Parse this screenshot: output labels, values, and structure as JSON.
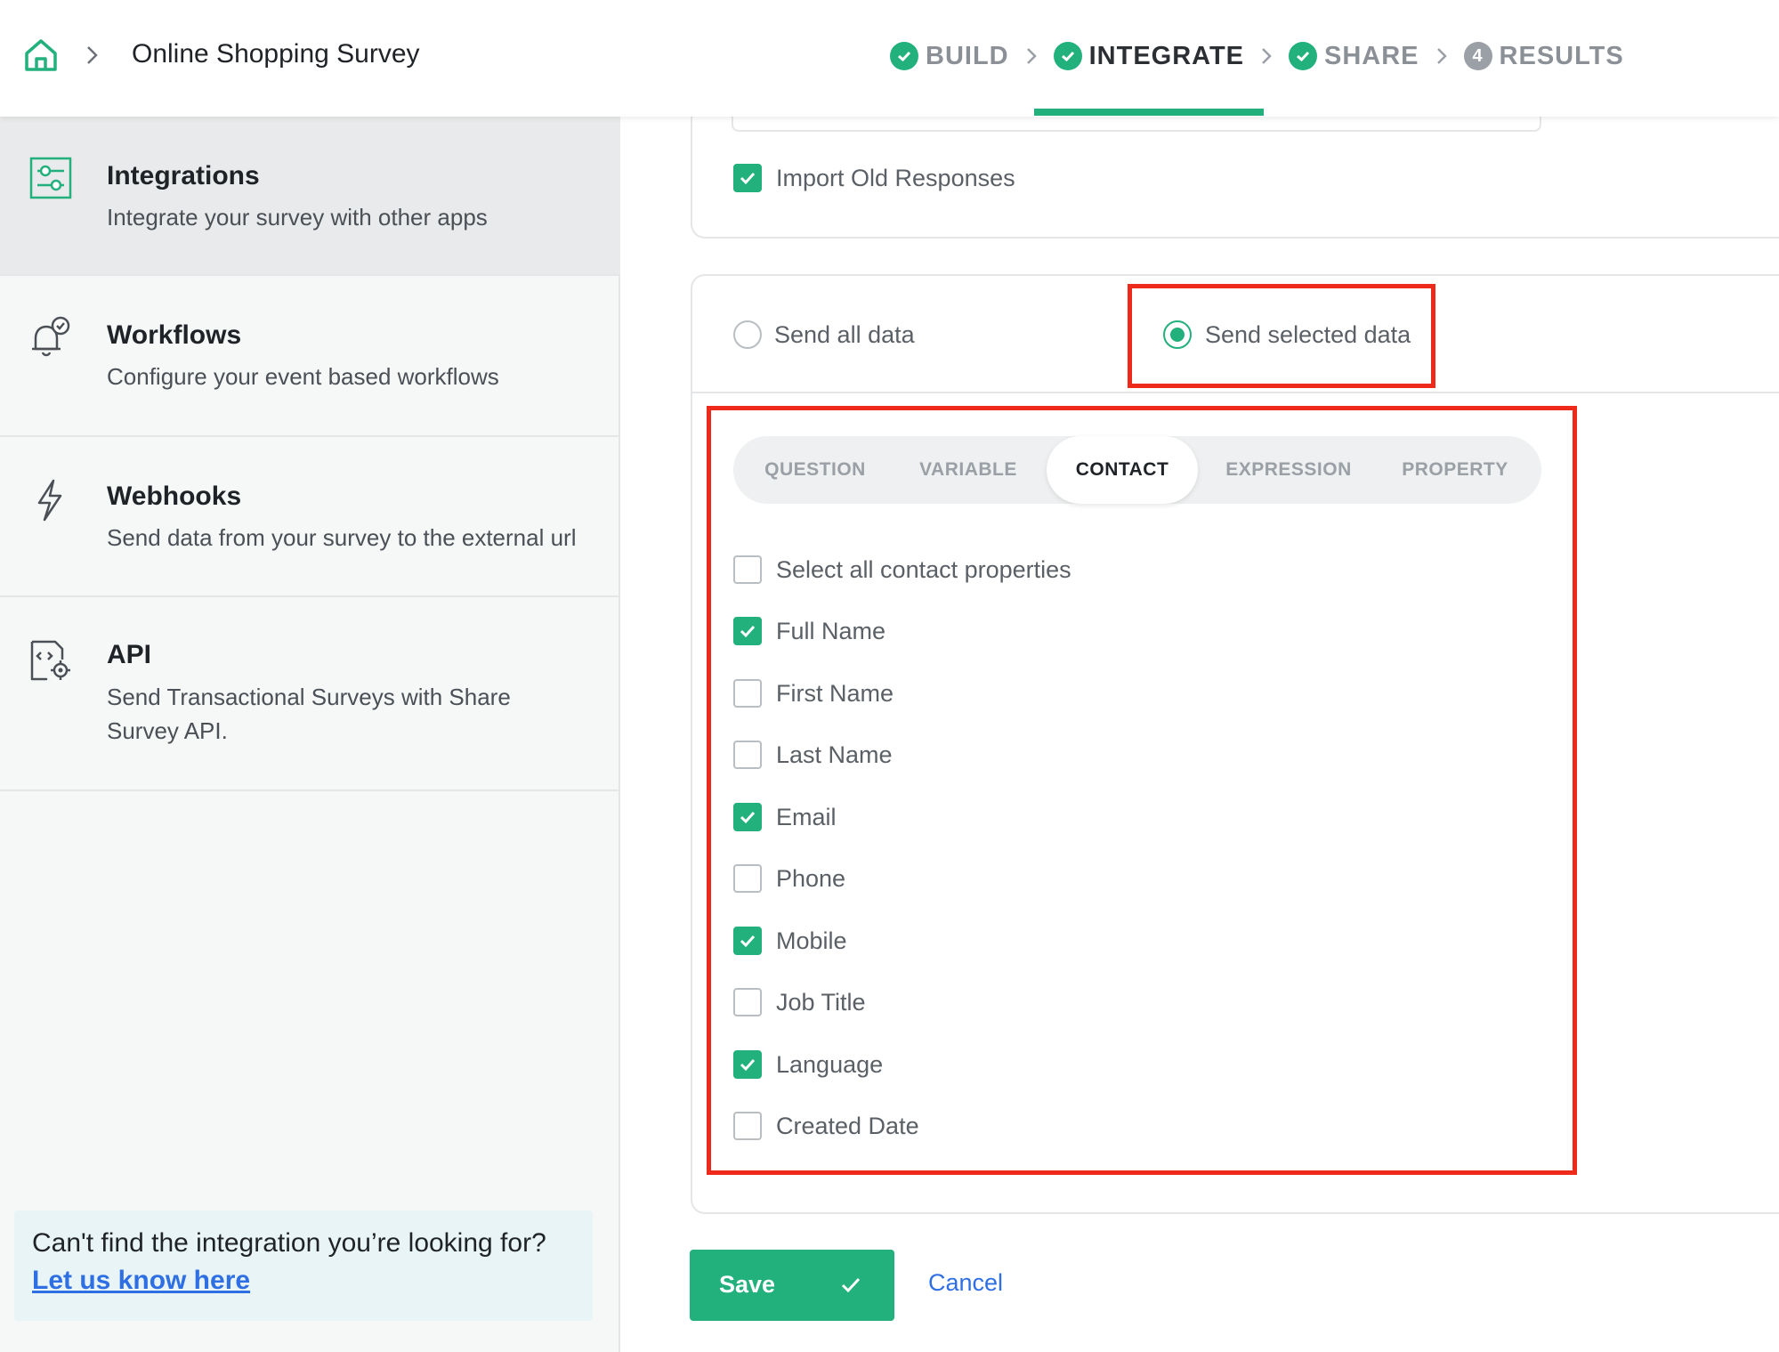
{
  "header": {
    "survey_title": "Online Shopping Survey",
    "steps": [
      {
        "label": "BUILD",
        "state": "done"
      },
      {
        "label": "INTEGRATE",
        "state": "active"
      },
      {
        "label": "SHARE",
        "state": "done"
      },
      {
        "label": "RESULTS",
        "state": "pending",
        "number": "4"
      }
    ]
  },
  "sidebar": {
    "items": [
      {
        "title": "Integrations",
        "desc": "Integrate your survey with other apps",
        "icon": "sliders-icon",
        "active": true
      },
      {
        "title": "Workflows",
        "desc": "Configure your event based workflows",
        "icon": "bell-check-icon",
        "active": false
      },
      {
        "title": "Webhooks",
        "desc": "Send data from your survey to the external url",
        "icon": "lightning-icon",
        "active": false
      },
      {
        "title": "API",
        "desc": "Send Transactional Surveys with Share Survey API.",
        "icon": "code-gear-icon",
        "active": false
      }
    ],
    "help": {
      "text": "Can't find the integration you’re looking for?",
      "link": "Let us know here"
    }
  },
  "main": {
    "import_old": {
      "label": "Import Old Responses",
      "checked": true
    },
    "send_options": [
      {
        "label": "Send all data",
        "selected": false
      },
      {
        "label": "Send selected data",
        "selected": true
      }
    ],
    "tabs": [
      "QUESTION",
      "VARIABLE",
      "CONTACT",
      "EXPRESSION",
      "PROPERTY"
    ],
    "active_tab": "CONTACT",
    "select_all": {
      "label": "Select all contact properties",
      "checked": false
    },
    "properties": [
      {
        "label": "Full Name",
        "checked": true
      },
      {
        "label": "First Name",
        "checked": false
      },
      {
        "label": "Last Name",
        "checked": false
      },
      {
        "label": "Email",
        "checked": true
      },
      {
        "label": "Phone",
        "checked": false
      },
      {
        "label": "Mobile",
        "checked": true
      },
      {
        "label": "Job Title",
        "checked": false
      },
      {
        "label": "Language",
        "checked": true
      },
      {
        "label": "Created Date",
        "checked": false
      }
    ],
    "save_label": "Save",
    "cancel_label": "Cancel"
  },
  "colors": {
    "accent": "#22b07d",
    "link": "#2f6fe4",
    "highlight": "#ee2a1c"
  }
}
